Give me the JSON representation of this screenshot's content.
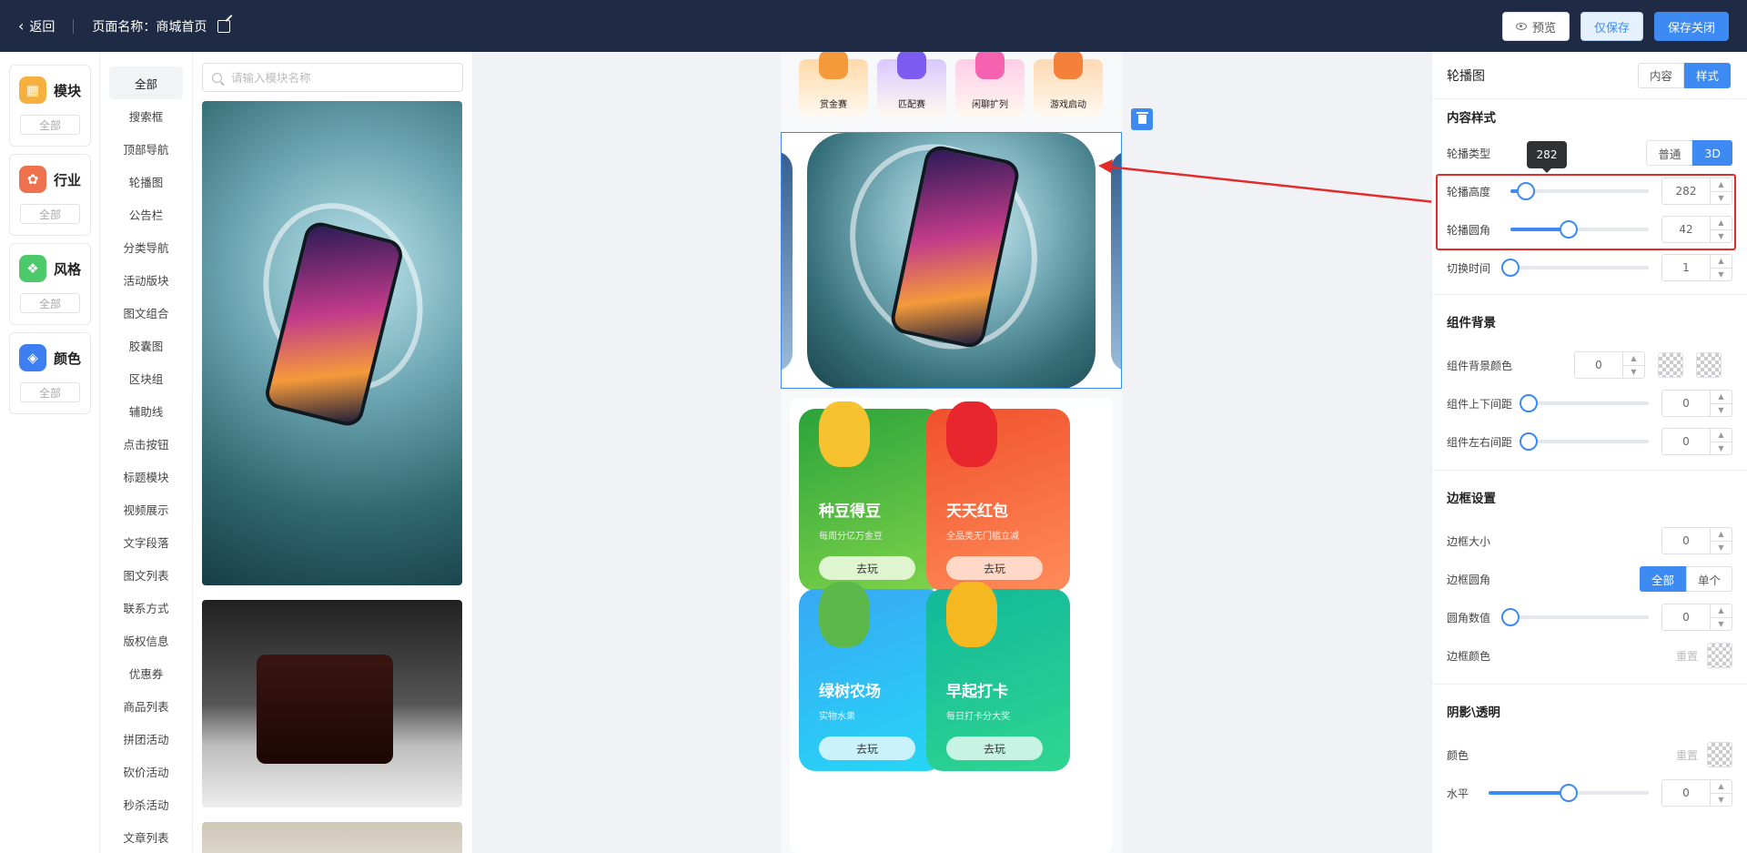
{
  "header": {
    "back_label": "返回",
    "page_name": "页面名称：商城首页",
    "preview_label": "预览",
    "save_only_label": "仅保存",
    "save_close_label": "保存关闭"
  },
  "categories": [
    {
      "name": "模块",
      "all": "全部",
      "color": "#f5b040",
      "glyph": "▦"
    },
    {
      "name": "行业",
      "all": "全部",
      "color": "#f0714e",
      "glyph": "✿"
    },
    {
      "name": "风格",
      "all": "全部",
      "color": "#4cc96b",
      "glyph": "❖"
    },
    {
      "name": "颜色",
      "all": "全部",
      "color": "#3d7ef2",
      "glyph": "◈"
    }
  ],
  "modules": [
    "全部",
    "搜索框",
    "顶部导航",
    "轮播图",
    "公告栏",
    "分类导航",
    "活动版块",
    "图文组合",
    "胶囊图",
    "区块组",
    "辅助线",
    "点击按钮",
    "标题模块",
    "视频展示",
    "文字段落",
    "图文列表",
    "联系方式",
    "版权信息",
    "优惠券",
    "商品列表",
    "拼团活动",
    "砍价活动",
    "秒杀活动",
    "文章列表"
  ],
  "search": {
    "placeholder": "请输入模块名称"
  },
  "canvas": {
    "game_nav": [
      {
        "label": "赏金赛",
        "color": "#ffd9a8",
        "icon_color": "#f59a3a"
      },
      {
        "label": "匹配赛",
        "color": "#d9c8ff",
        "icon_color": "#7c5cf0"
      },
      {
        "label": "闲聊扩列",
        "color": "#ffcde8",
        "icon_color": "#f562b0"
      },
      {
        "label": "游戏启动",
        "color": "#ffd9b3",
        "icon_color": "#f5803a"
      }
    ],
    "activities": [
      {
        "title": "种豆得豆",
        "sub": "每周分亿万金豆",
        "btn": "去玩",
        "bg": "linear-gradient(160deg,#2aa33a,#7fd34a)",
        "btn_bg": "#dff5cf",
        "blob": "#f7c230"
      },
      {
        "title": "天天红包",
        "sub": "全品类无门槛立减",
        "btn": "去玩",
        "bg": "linear-gradient(160deg,#f0502b,#ff8c5a)",
        "btn_bg": "#ffd8c8",
        "blob": "#e8262e"
      },
      {
        "title": "绿树农场",
        "sub": "实物水果",
        "btn": "去玩",
        "bg": "linear-gradient(160deg,#38a8f5,#26d6f5)",
        "btn_bg": "#c9f2fb",
        "blob": "#5cb84a"
      },
      {
        "title": "早起打卡",
        "sub": "每日打卡分大奖",
        "btn": "去玩",
        "bg": "linear-gradient(160deg,#12b89a,#2fd690)",
        "btn_bg": "#c6f3e3",
        "blob": "#f5b820"
      }
    ]
  },
  "panel": {
    "title": "轮播图",
    "tab_content": "内容",
    "tab_style": "样式",
    "content_style": {
      "title": "内容样式",
      "type_label": "轮播类型",
      "type_normal": "普通",
      "type_3d": "3D",
      "height_label": "轮播高度",
      "height_value": "282",
      "height_pct": 11,
      "radius_label": "轮播圆角",
      "radius_value": "42",
      "radius_pct": 42,
      "interval_label": "切换时间",
      "interval_value": "1",
      "interval_pct": 0,
      "tooltip": "282"
    },
    "bg": {
      "title": "组件背景",
      "color_label": "组件背景颜色",
      "color_value": "0",
      "vpad_label": "组件上下间距",
      "vpad_value": "0",
      "hpad_label": "组件左右间距",
      "hpad_value": "0"
    },
    "border": {
      "title": "边框设置",
      "size_label": "边框大小",
      "size_value": "0",
      "radius_label": "边框圆角",
      "radius_all": "全部",
      "radius_single": "单个",
      "radius_num_label": "圆角数值",
      "radius_num_value": "0",
      "color_label": "边框颜色",
      "reset": "重置"
    },
    "shadow": {
      "title": "阴影\\透明",
      "color_label": "颜色",
      "reset": "重置",
      "h_label": "水平",
      "h_value": "0",
      "h_pct": 50
    }
  }
}
